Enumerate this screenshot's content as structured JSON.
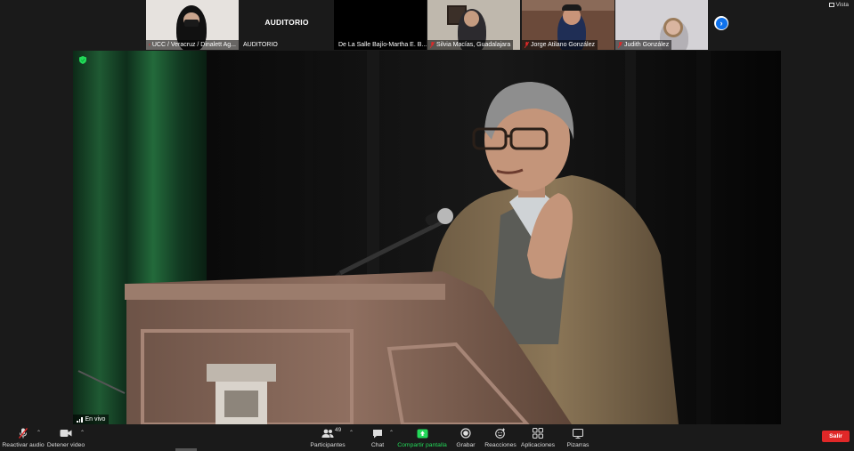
{
  "gallery": {
    "tiles": [
      {
        "name": "UCC / Veracruz / Dinalett Ag...",
        "muted": true,
        "type": "video"
      },
      {
        "name": "AUDITORIO",
        "muted": false,
        "type": "label",
        "label": "AUDITORIO"
      },
      {
        "name": "De La Salle Bajío-Martha E. B...",
        "muted": true,
        "type": "off"
      },
      {
        "name": "Silvia Macías, Guadalajara",
        "muted": true,
        "type": "video"
      },
      {
        "name": "Jorge Atilano González",
        "muted": true,
        "type": "video"
      },
      {
        "name": "Judith González",
        "muted": true,
        "type": "video"
      }
    ],
    "view_label": "Vista"
  },
  "stage": {
    "live_label": "En vivo"
  },
  "toolbar": {
    "audio_label": "Reactivar audio",
    "video_label": "Detener video",
    "participants_label": "Participantes",
    "participants_count": "49",
    "chat_label": "Chat",
    "share_label": "Compartir pantalla",
    "record_label": "Grabar",
    "reactions_label": "Reacciones",
    "apps_label": "Aplicaciones",
    "whiteboard_label": "Pizarras",
    "leave_label": "Salir"
  },
  "colors": {
    "accent_blue": "#0e72ed",
    "share_green": "#23d959",
    "leave_red": "#e02828",
    "muted_red": "#e02828"
  }
}
